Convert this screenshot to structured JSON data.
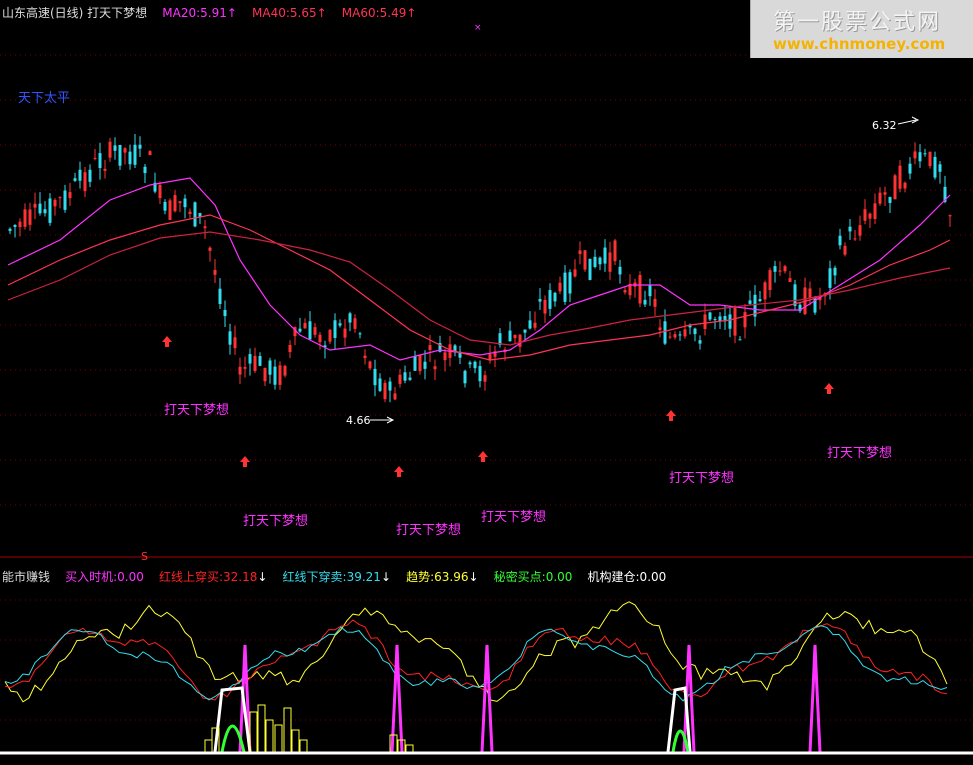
{
  "main_header": {
    "title": "山东高速(日线) 打天下梦想",
    "ma20": "MA20:5.91",
    "ma40": "MA40:5.65",
    "ma60": "MA60:5.49",
    "up_arrow": "↑"
  },
  "indicator_label": "天下太平",
  "price_labels": {
    "high": "6.32",
    "low": "4.66"
  },
  "signal_text": "打天下梦想",
  "sub_header": {
    "name": "能市赚钱",
    "buy": "买入时机:0.00",
    "red_cross_up": "红线上穿买:32.18",
    "red_cross_down": "红线下穿卖:39.21",
    "trend": "趋势:63.96",
    "secret_buy": "秘密买点:0.00",
    "inst_build": "机构建仓:0.00",
    "down_arrow": "↓"
  },
  "watermark": {
    "title": "第一股票公式网",
    "url": "www.chnmoney.com"
  },
  "colors": {
    "ma20": "#ff33ff",
    "ma40": "#ff3355",
    "ma60": "#ff3355",
    "candle_up": "#ff3333",
    "candle_down": "#33ddee",
    "signal_arrow": "#ff3333",
    "signal_text": "#ff33ff",
    "sub_red": "#ff2222",
    "sub_cyan": "#33ddee",
    "sub_yellow": "#ffff33",
    "sub_magenta": "#ff33ff",
    "sub_green": "#33ff33",
    "sub_white": "#ffffff"
  },
  "chart_data": [
    {
      "type": "candlestick",
      "series": [
        {
          "name": "MA20",
          "values": []
        },
        {
          "name": "MA40",
          "values": []
        },
        {
          "name": "MA60",
          "values": []
        }
      ],
      "annotations": [
        "6.32",
        "4.66",
        "打天下梦想"
      ]
    },
    {
      "type": "line",
      "series": [
        {
          "name": "买入时机",
          "last": 0.0
        },
        {
          "name": "红线上穿买",
          "last": 32.18
        },
        {
          "name": "红线下穿卖",
          "last": 39.21
        },
        {
          "name": "趋势",
          "last": 63.96
        },
        {
          "name": "秘密买点",
          "last": 0.0
        },
        {
          "name": "机构建仓",
          "last": 0.0
        }
      ]
    }
  ]
}
